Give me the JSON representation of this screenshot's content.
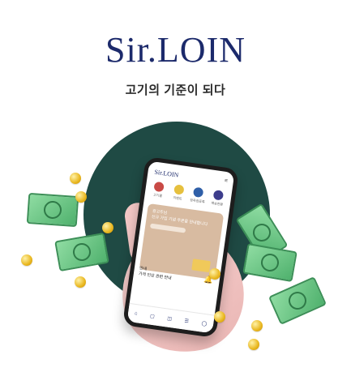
{
  "brand": {
    "name": "Sir.LOIN"
  },
  "header": {
    "tagline": "고기의 기준이 되다"
  },
  "phone": {
    "app_title": "Sir.LOIN",
    "menu_icon": "≡",
    "quick_icons": [
      {
        "label": "고기몰"
      },
      {
        "label": "이벤트"
      },
      {
        "label": "정육점등록"
      },
      {
        "label": "배송현황"
      }
    ],
    "card": {
      "line1": "광고주님",
      "line2": "신규 가입 기념 쿠폰을 안내합니다"
    },
    "notice": {
      "title": "안내",
      "line": "가격 인상 관련 안내"
    },
    "tabbar": [
      "home-icon",
      "store-icon",
      "cart-icon",
      "list-icon",
      "user-icon"
    ]
  },
  "colors": {
    "brand": "#1c2a6b",
    "circle": "#1f4a44",
    "coin": "#e9b71f",
    "bill": "#4fb16d"
  }
}
